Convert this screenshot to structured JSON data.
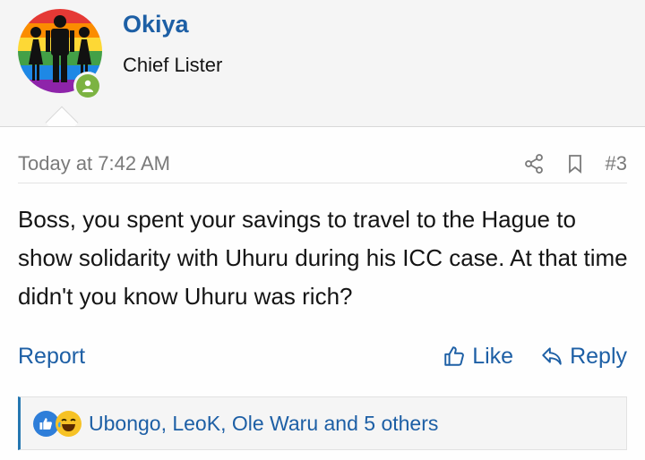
{
  "user": {
    "name": "Okiya",
    "title": "Chief Lister",
    "avatar_icon": "rainbow-family-avatar",
    "online_status_color": "#7cb342"
  },
  "post": {
    "timestamp": "Today at 7:42 AM",
    "number": "#3",
    "body": "Boss, you spent your savings to travel to the Hague to show solidarity with Uhuru during his ICC case. At that time didn't you know Uhuru was rich?"
  },
  "actions": {
    "report": "Report",
    "like": "Like",
    "reply": "Reply"
  },
  "reactions": {
    "icons": [
      "like-icon",
      "laugh-icon"
    ],
    "summary": "Ubongo, LeoK, Ole Waru and 5 others"
  },
  "colors": {
    "link": "#1d5fa5",
    "accent_border": "#2577b1"
  }
}
